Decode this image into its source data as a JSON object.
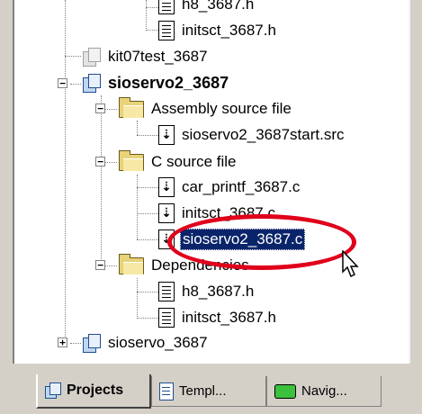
{
  "tree": {
    "items": [
      {
        "label": "h8_3687.h",
        "icon": "header-file-icon",
        "partial": true
      },
      {
        "label": "initsct_3687.h",
        "icon": "header-file-icon"
      },
      {
        "label": "kit07test_3687",
        "icon": "project-icon-dimmed"
      },
      {
        "label": "sioservo2_3687",
        "icon": "project-icon",
        "expander": "−"
      },
      {
        "label": "Assembly source file",
        "icon": "folder-icon",
        "expander": "−"
      },
      {
        "label": "sioservo2_3687start.src",
        "icon": "source-file-icon"
      },
      {
        "label": "C source file",
        "icon": "folder-icon",
        "expander": "−"
      },
      {
        "label": "car_printf_3687.c",
        "icon": "source-file-icon"
      },
      {
        "label": "initsct_3687.c",
        "icon": "source-file-icon"
      },
      {
        "label": "sioservo2_3687.c",
        "icon": "source-file-icon",
        "selected": true
      },
      {
        "label": "Dependencies",
        "icon": "folder-icon",
        "expander": "−"
      },
      {
        "label": "h8_3687.h",
        "icon": "header-file-icon"
      },
      {
        "label": "initsct_3687.h",
        "icon": "header-file-icon"
      },
      {
        "label": "sioservo_3687",
        "icon": "project-icon",
        "expander": "+"
      }
    ]
  },
  "tabs": [
    {
      "label": "Projects",
      "icon": "projects-tab-icon",
      "active": true
    },
    {
      "label": "Templ...",
      "icon": "templates-tab-icon"
    },
    {
      "label": "Navig...",
      "icon": "navigation-tab-icon"
    }
  ],
  "colors": {
    "selection": "#0a246a",
    "highlight_ring": "#e0001b",
    "panel": "#d4d0c8"
  }
}
